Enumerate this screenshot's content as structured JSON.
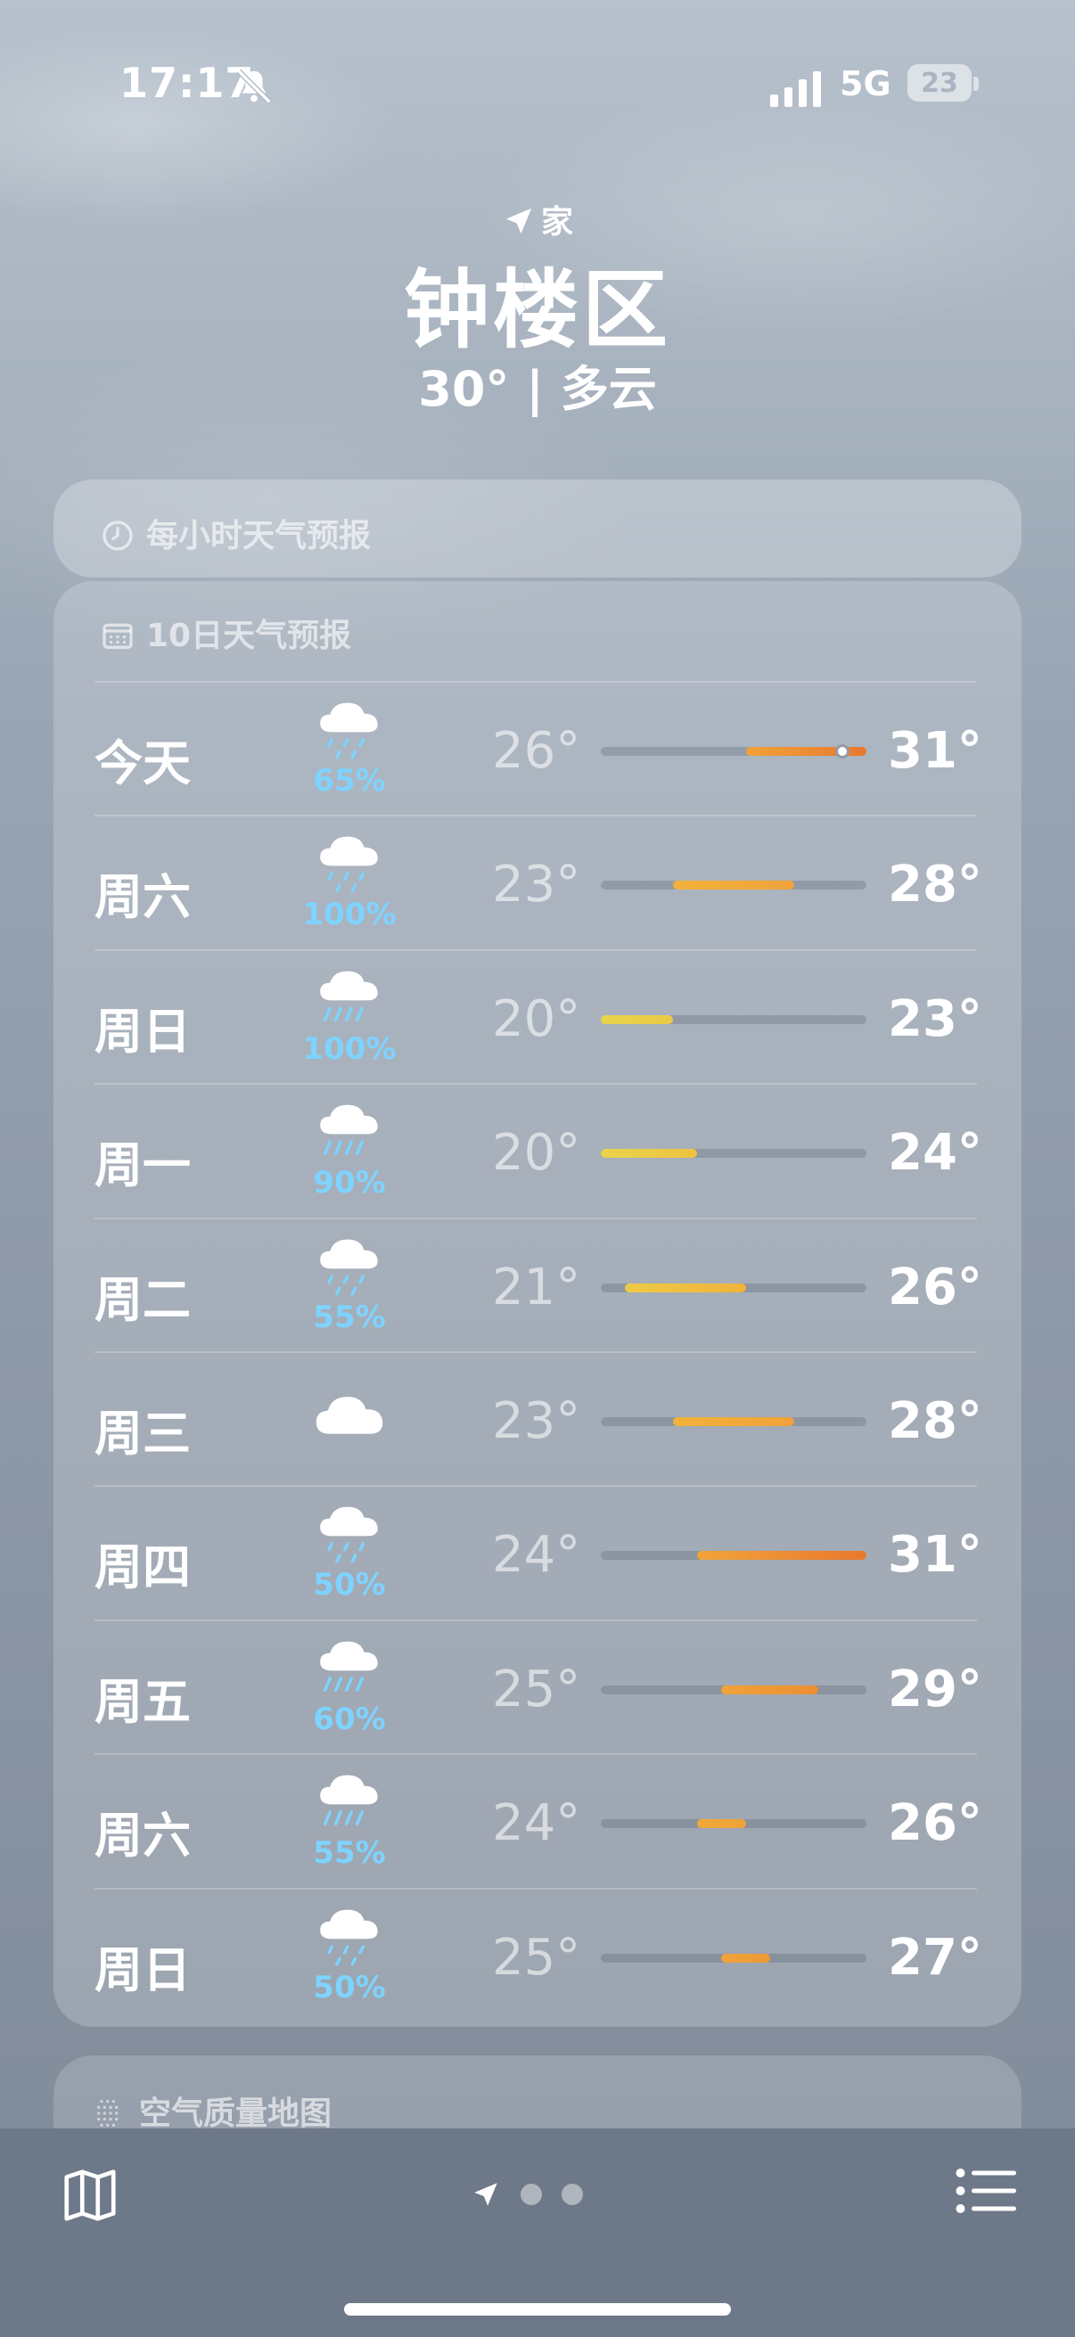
{
  "status_bar": {
    "time": "17:17",
    "network": "5G",
    "battery": "23"
  },
  "header": {
    "location_tag": "家",
    "city": "钟楼区",
    "condition": "30° | 多云"
  },
  "hourly_card": {
    "title": "每小时天气预报"
  },
  "forecast_card": {
    "title": "10日天气预报",
    "range_min": 20,
    "range_max": 31,
    "current_temp": 30,
    "days": [
      {
        "day": "今天",
        "icon": "cloud-rain-icon",
        "precip": "65%",
        "low": "26°",
        "high": "31°",
        "low_val": 26,
        "high_val": 31,
        "color_from": "#f0a23a",
        "color_to": "#e8782e"
      },
      {
        "day": "周六",
        "icon": "cloud-rain-icon",
        "precip": "100%",
        "low": "23°",
        "high": "28°",
        "low_val": 23,
        "high_val": 28,
        "color_from": "#f2b23b",
        "color_to": "#f0a23a"
      },
      {
        "day": "周日",
        "icon": "cloud-heavy-rain-icon",
        "precip": "100%",
        "low": "20°",
        "high": "23°",
        "low_val": 20,
        "high_val": 23,
        "color_from": "#e8d44a",
        "color_to": "#ecc948"
      },
      {
        "day": "周一",
        "icon": "cloud-heavy-rain-icon",
        "precip": "90%",
        "low": "20°",
        "high": "24°",
        "low_val": 20,
        "high_val": 24,
        "color_from": "#e8d44a",
        "color_to": "#efc243"
      },
      {
        "day": "周二",
        "icon": "cloud-rain-icon",
        "precip": "55%",
        "low": "21°",
        "high": "26°",
        "low_val": 21,
        "high_val": 26,
        "color_from": "#edcb45",
        "color_to": "#f1b23c"
      },
      {
        "day": "周三",
        "icon": "cloud-icon",
        "precip": "",
        "low": "23°",
        "high": "28°",
        "low_val": 23,
        "high_val": 28,
        "color_from": "#f2b23b",
        "color_to": "#f0a23a"
      },
      {
        "day": "周四",
        "icon": "cloud-rain-icon",
        "precip": "50%",
        "low": "24°",
        "high": "31°",
        "low_val": 24,
        "high_val": 31,
        "color_from": "#f1a43a",
        "color_to": "#e8782e"
      },
      {
        "day": "周五",
        "icon": "cloud-heavy-rain-icon",
        "precip": "60%",
        "low": "25°",
        "high": "29°",
        "low_val": 25,
        "high_val": 29,
        "color_from": "#f0a23a",
        "color_to": "#ed8f33"
      },
      {
        "day": "周六",
        "icon": "cloud-heavy-rain-icon",
        "precip": "55%",
        "low": "24°",
        "high": "26°",
        "low_val": 24,
        "high_val": 26,
        "color_from": "#f1a83b",
        "color_to": "#f0a23a"
      },
      {
        "day": "周日",
        "icon": "cloud-rain-icon",
        "precip": "50%",
        "low": "25°",
        "high": "27°",
        "low_val": 25,
        "high_val": 27,
        "color_from": "#f0a23a",
        "color_to": "#ee9a37"
      }
    ]
  },
  "air_card": {
    "title": "空气质量地图"
  },
  "tab_bar": {
    "pages": 3,
    "active_page": 1
  }
}
